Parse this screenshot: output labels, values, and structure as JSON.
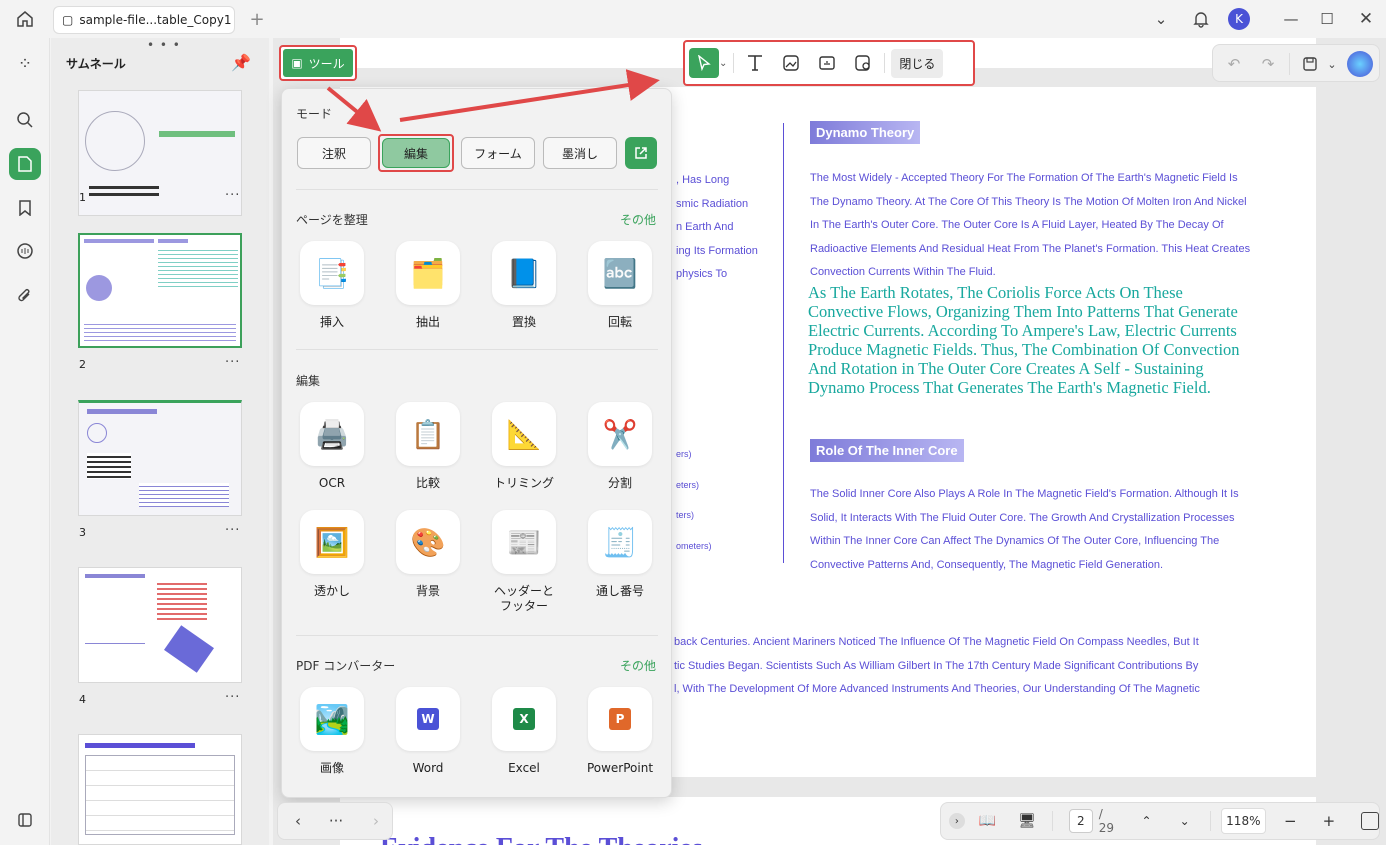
{
  "titlebar": {
    "tab_title": "sample-file...table_Copy1",
    "avatar_letter": "K"
  },
  "sidebar": {
    "panel_title": "サムネール",
    "pages": [
      "1",
      "2",
      "3",
      "4"
    ]
  },
  "tools_button": {
    "label": "ツール"
  },
  "toolbar": {
    "close_label": "閉じる"
  },
  "popup": {
    "mode_title": "モード",
    "modes": [
      "注釈",
      "編集",
      "フォーム",
      "墨消し"
    ],
    "organize_title": "ページを整理",
    "organize_more": "その他",
    "organize_items": [
      "挿入",
      "抽出",
      "置換",
      "回転"
    ],
    "edit_title": "編集",
    "edit_items": [
      "OCR",
      "比較",
      "トリミング",
      "分割",
      "透かし",
      "背景",
      "ヘッダーと\nフッター",
      "通し番号"
    ],
    "converter_title": "PDF コンバーター",
    "converter_more": "その他",
    "converter_items": [
      "画像",
      "Word",
      "Excel",
      "PowerPoint"
    ]
  },
  "document": {
    "heading1": "Dynamo Theory",
    "para1": [
      "The Most Widely - Accepted Theory For The Formation Of The Earth's Magnetic Field Is",
      "The Dynamo Theory. At The Core Of This Theory Is The Motion Of Molten Iron And Nickel",
      "In The Earth's Outer Core. The Outer Core Is A Fluid Layer, Heated By The Decay Of",
      "Radioactive Elements And Residual Heat From The Planet's Formation. This Heat Creates",
      "Convection Currents Within The Fluid."
    ],
    "para2": [
      "As The Earth Rotates, The Coriolis Force Acts On These",
      "Convective Flows, Organizing Them Into Patterns That Generate",
      "Electric Currents. According To Ampere's Law, Electric Currents",
      "Produce Magnetic Fields. Thus, The Combination Of Convection",
      "And Rotation in The Outer Core Creates A Self - Sustaining",
      "Dynamo Process That Generates The Earth's Magnetic Field."
    ],
    "heading2": "Role Of The Inner Core",
    "para3": [
      "The Solid Inner Core Also Plays A Role In The Magnetic Field's Formation. Although It Is",
      "Solid, It Interacts With The Fluid Outer Core. The Growth And Crystallization Processes",
      "Within The Inner Core Can Affect The Dynamics Of The Outer Core, Influencing The",
      "Convective Patterns And, Consequently, The Magnetic Field Generation."
    ],
    "left_fragments": [
      ", Has Long",
      "smic Radiation",
      "n Earth And",
      "ing Its Formation",
      "physics To"
    ],
    "left_fragments2": [
      "ers)",
      "eters)",
      "ters)",
      "ometers)"
    ],
    "bottom_lines": [
      "back Centuries. Ancient Mariners Noticed The Influence Of The Magnetic Field On Compass Needles, But It",
      "tic Studies Began. Scientists Such As William Gilbert In The 17th Century Made Significant Contributions By",
      "l, With The Development Of More Advanced Instruments And Theories, Our Understanding Of The Magnetic"
    ],
    "next_page_title": "Evidence For The Theories"
  },
  "bottombar": {
    "current_page": "2",
    "total_pages": "/ 29",
    "zoom": "118%"
  },
  "colors": {
    "accent_green": "#3aa35c",
    "highlight_red": "#e04848",
    "text_blue": "#5b4fd6",
    "teal": "#18a89e"
  }
}
